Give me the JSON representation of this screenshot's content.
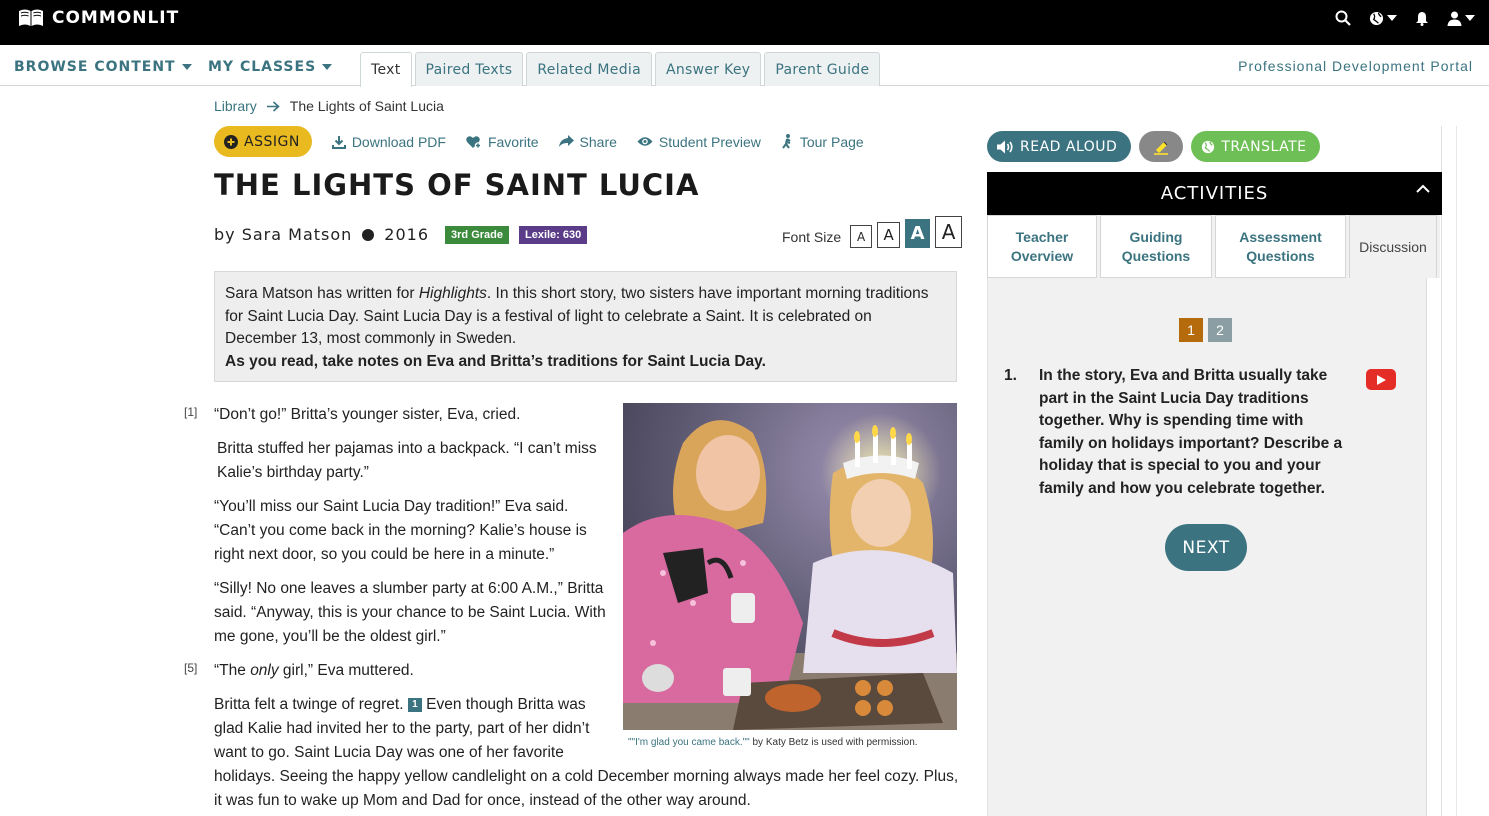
{
  "brand": {
    "logo_text": "COMMONLIT"
  },
  "header_icons": [
    "search-icon",
    "globe-icon",
    "bell-icon",
    "user-icon"
  ],
  "nav": {
    "browse": "BROWSE CONTENT",
    "classes": "MY CLASSES",
    "tabs": [
      {
        "label": "Text",
        "active": true
      },
      {
        "label": "Paired Texts",
        "active": false
      },
      {
        "label": "Related Media",
        "active": false
      },
      {
        "label": "Answer Key",
        "active": false
      },
      {
        "label": "Parent Guide",
        "active": false
      }
    ],
    "pdp": "Professional Development Portal"
  },
  "breadcrumb": {
    "library": "Library",
    "current": "The Lights of Saint Lucia"
  },
  "actions": {
    "assign": "ASSIGN",
    "download": "Download PDF",
    "favorite": "Favorite",
    "share": "Share",
    "preview": "Student Preview",
    "tour": "Tour Page"
  },
  "text": {
    "title": "THE LIGHTS OF SAINT LUCIA",
    "author": "by Sara Matson",
    "year": "2016",
    "grade": "3rd Grade",
    "lexile": "Lexile: 630",
    "font_size_label": "Font Size",
    "font_sizes": [
      "A",
      "A",
      "A",
      "A"
    ],
    "intro_pre": "Sara Matson has written for ",
    "intro_em": "Highlights",
    "intro_post": ". In this short story, two sisters have important morning traditions for Saint Lucia Day. Saint Lucia Day is a festival of light to celebrate a Saint. It is celebrated on December 13, most commonly in Sweden.",
    "intro_bold": "As you read, take notes on Eva and Britta’s traditions for Saint Lucia Day.",
    "para_nums": [
      "[1]",
      "[5]"
    ],
    "p1": "“Don’t go!” Britta’s younger sister, Eva, cried.",
    "p2": "Britta stuffed her pajamas into a backpack. “I can’t miss Kalie’s birthday party.”",
    "p3": "“You’ll miss our Saint Lucia Day tradition!” Eva said. “Can’t you come back in the morning? Kalie’s house is right next door, so you could be here in a minute.”",
    "p4": "“Silly! No one leaves a slumber party at 6:00 A.M.,” Britta said. “Anyway, this is your chance to be Saint Lucia. With me gone, you’ll be the oldest girl.”",
    "p5_pre": "“The ",
    "p5_em": "only",
    "p5_post": " girl,” Eva muttered.",
    "p6_pre": "Britta felt a twinge of regret.",
    "p6_footnote": "1",
    "p6_post": " Even though Britta was glad Kalie had invited her to the party, part of her didn’t want to go. Saint Lucia Day was one of her favorite",
    "p6_cont": "holidays. Seeing the happy yellow candlelight on a cold December morning always made her feel cozy. Plus, it was fun to wake up Mom and Dad for once, instead of the other way around.",
    "caption_link": "\"\"I'm glad you came back.\"\"",
    "caption_rest": " by Katy Betz is used with permission."
  },
  "right": {
    "read_aloud": "READ ALOUD",
    "translate": "TRANSLATE",
    "activities": "ACTIVITIES",
    "tabs": [
      {
        "label": "Teacher Overview"
      },
      {
        "label": "Guiding Questions"
      },
      {
        "label": "Assessment Questions"
      },
      {
        "label": "Discussion",
        "active": true
      }
    ],
    "pages": [
      "1",
      "2"
    ],
    "question_num": "1.",
    "question": "In the story, Eva and Britta usually take part in the Saint Lucia Day traditions together. Why is spending time with family on holidays important? Describe a holiday that is special to you and your family and how you celebrate together.",
    "next": "NEXT"
  },
  "colors": {
    "accent": "#3b7480",
    "assign": "#e9b920",
    "grade": "#3c8b3c",
    "lexile": "#5b3c89",
    "translate": "#6fbf57",
    "page_active": "#b56a0c"
  }
}
